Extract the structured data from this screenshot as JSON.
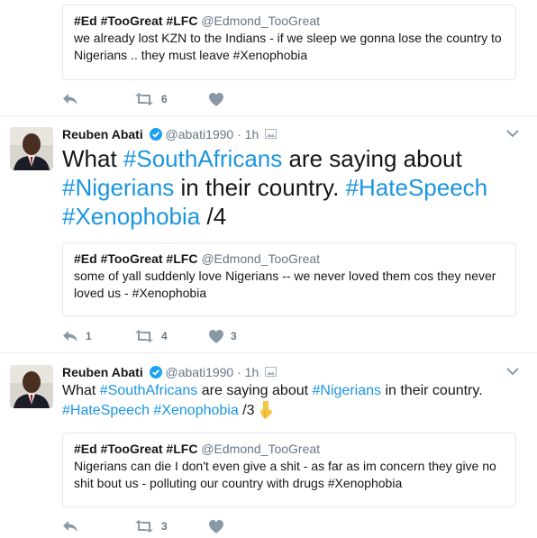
{
  "tweets": [
    {
      "quote": {
        "name": "#Ed #TooGreat #LFC",
        "handle": "@Edmond_TooGreat",
        "text": "we already lost KZN to the Indians - if we sleep we gonna lose the country to Nigerians .. they must leave  #Xenophobia"
      },
      "actions": {
        "reply": "",
        "retweet": "6",
        "like": ""
      }
    },
    {
      "author": {
        "name": "Reuben Abati",
        "handle": "@abati1990",
        "time": "· 1h"
      },
      "text": {
        "p1": "What ",
        "t1": "#SouthAfricans",
        "p2": " are saying about ",
        "t2": "#Nigerians",
        "p3": " in their country. ",
        "t3": "#HateSpeech",
        "t4": "#Xenophobia",
        "p4": " /4"
      },
      "quote": {
        "name": "#Ed #TooGreat #LFC",
        "handle": "@Edmond_TooGreat",
        "text": "some of yall suddenly love Nigerians -- we never loved them cos they never loved us -  #Xenophobia"
      },
      "actions": {
        "reply": "1",
        "retweet": "4",
        "like": "3"
      }
    },
    {
      "author": {
        "name": "Reuben Abati",
        "handle": "@abati1990",
        "time": "· 1h"
      },
      "text": {
        "p1": "What ",
        "t1": "#SouthAfricans",
        "p2": " are saying about ",
        "t2": "#Nigerians",
        "p3": " in their country. ",
        "t3": "#HateSpeech",
        "t4": "#Xenophobia",
        "p4": " /3"
      },
      "quote": {
        "name": "#Ed #TooGreat #LFC",
        "handle": "@Edmond_TooGreat",
        "text": "Nigerians can die I don't even give a shit - as far as im concern they give no shit bout us - polluting our country with drugs #Xenophobia"
      },
      "actions": {
        "reply": "",
        "retweet": "3",
        "like": ""
      }
    }
  ],
  "colors": {
    "link": "#1b95e0",
    "muted": "#657786",
    "border": "#e1e8ed",
    "verified": "#1da1f2"
  },
  "icons": [
    "reply-icon",
    "retweet-icon",
    "heart-icon",
    "verified-icon",
    "caret-down-icon",
    "photo-icon",
    "pointing-down-emoji"
  ]
}
